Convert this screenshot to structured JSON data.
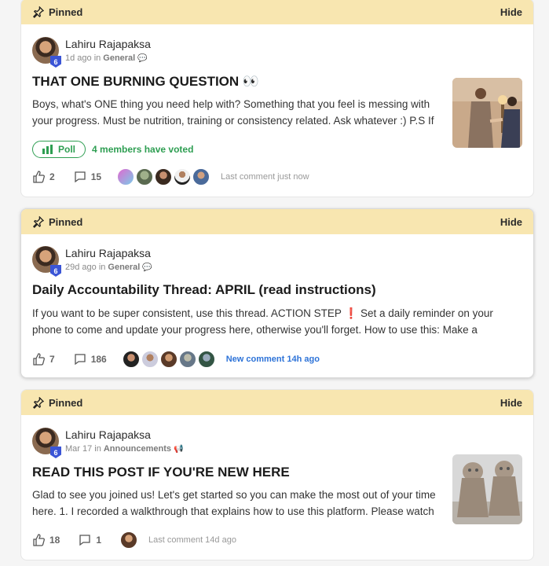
{
  "posts": [
    {
      "pinned_label": "Pinned",
      "hide_label": "Hide",
      "author": "Lahiru Rajapaksa",
      "level": "6",
      "time": "1d ago in",
      "category": "General",
      "title": "THAT ONE BURNING QUESTION 👀",
      "body": "Boys, what's ONE thing you need help with? Something that you feel is messing with your progress. Must be nutrition, training or consistency related. Ask whatever :) P.S If",
      "poll_label": "Poll",
      "poll_votes": "4 members have voted",
      "likes": "2",
      "comments": "15",
      "last_comment": "Last comment just now",
      "thumb_icon": "handshake-photo"
    },
    {
      "pinned_label": "Pinned",
      "hide_label": "Hide",
      "author": "Lahiru Rajapaksa",
      "level": "6",
      "time": "29d ago in",
      "category": "General",
      "title": "Daily Accountability Thread: APRIL (read instructions)",
      "body": "If you want to be super consistent, use this thread. ACTION STEP ❗ Set a daily reminder on your phone to come and update your progress here, otherwise you'll forget. How to use this: Make a",
      "likes": "7",
      "comments": "186",
      "new_comment": "New comment 14h ago"
    },
    {
      "pinned_label": "Pinned",
      "hide_label": "Hide",
      "author": "Lahiru Rajapaksa",
      "level": "6",
      "time": "Mar 17 in",
      "category": "Announcements",
      "title": "READ THIS POST IF YOU'RE NEW HERE",
      "body": "Glad to see you joined us! Let's get started so you can make the most out of your time here. 1. I recorded a walkthrough that explains how to use this platform. Please watch",
      "likes": "18",
      "comments": "1",
      "last_comment": "Last comment 14d ago",
      "thumb_icon": "statues-photo"
    }
  ]
}
